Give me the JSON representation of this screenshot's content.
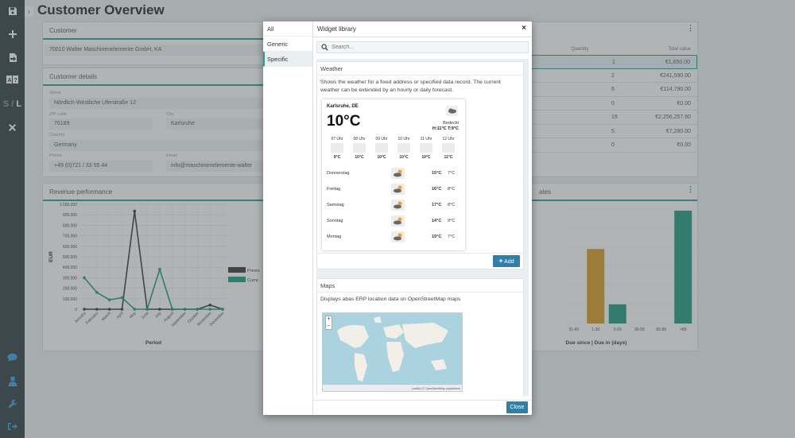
{
  "app": {
    "page_title": "Customer Overview",
    "sidebar": [
      "save-icon",
      "add-icon",
      "export-icon",
      "language-icon",
      "size-toggle",
      "close-icon",
      "chat-icon",
      "user-icon",
      "wrench-icon",
      "logout-icon"
    ],
    "size_toggle": {
      "small": "S",
      "sep": "/",
      "large": "L"
    }
  },
  "customer_panel": {
    "title": "Customer",
    "value": "70010 Walter Maschinenelemente GmbH, KA"
  },
  "customer_details": {
    "title": "Customer details",
    "street_label": "Street",
    "street": "Nördlich-Westliche Uferstraße 12",
    "zip_label": "ZIP code",
    "zip": "76189",
    "city_label": "City",
    "city": "Karlsruhe",
    "country_label": "Country",
    "country": "Germany",
    "phone_label": "Phone",
    "phone": "+49 (0)721 / 33 55 44",
    "email_label": "Email",
    "email": "info@maschinenelemente-walter"
  },
  "orders_table": {
    "col_quantity": "Quantity",
    "col_total": "Total value",
    "rows": [
      {
        "quantity": "1",
        "total": "€1,650.00"
      },
      {
        "quantity": "2",
        "total": "€241,590.00"
      },
      {
        "quantity": "6",
        "total": "€114,790.00"
      },
      {
        "quantity": "0",
        "total": "€0.00"
      },
      {
        "quantity": "19",
        "total": "€2,256,257.50"
      },
      {
        "quantity": "5",
        "total": "€7,280.00"
      },
      {
        "quantity": "0",
        "total": "€0.00"
      }
    ]
  },
  "revenue_panel": {
    "title": "Revenue performance"
  },
  "due_panel": {
    "title_fragment": "ates",
    "xlabel": "Due since | Due in (days)"
  },
  "chart_data": [
    {
      "type": "line",
      "ylabel": "EUR",
      "xlabel": "Period",
      "ylim": [
        0,
        1000000
      ],
      "yticks": [
        "1.000.000",
        "900.000",
        "800.000",
        "700.000",
        "600.000",
        "500.000",
        "400.000",
        "300.000",
        "200.000",
        "100.000",
        "0"
      ],
      "categories": [
        "January",
        "February",
        "March",
        "April",
        "May",
        "June",
        "July",
        "August",
        "September",
        "October",
        "November",
        "December"
      ],
      "series": [
        {
          "name": "Previo",
          "color": "#333333",
          "values": [
            0,
            0,
            0,
            0,
            935000,
            0,
            0,
            0,
            0,
            0,
            40000,
            0
          ]
        },
        {
          "name": "Curre",
          "color": "#1a9a7e",
          "values": [
            300000,
            160000,
            90000,
            110000,
            0,
            0,
            380000,
            0,
            0,
            0,
            0,
            0
          ]
        }
      ],
      "legend": "right"
    },
    {
      "type": "bar",
      "xlabel": "Due since | Due in (days)",
      "categories": [
        "31-60",
        "1-30",
        "0-29",
        "30-59",
        "60-89",
        ">89"
      ],
      "values": [
        0,
        0.66,
        0.17,
        0,
        0,
        1.0
      ],
      "colors": [
        "#d99a1e",
        "#d99a1e",
        "#1a9a7e",
        "#1a9a7e",
        "#1a9a7e",
        "#1a9a7e"
      ]
    }
  ],
  "widget_library": {
    "title": "Widget library",
    "categories": [
      {
        "label": "All",
        "active": false
      },
      {
        "label": "Generic",
        "active": false
      },
      {
        "label": "Specific",
        "active": true
      }
    ],
    "search_placeholder": "Search...",
    "weather": {
      "title": "Weather",
      "description": "Shows the weather for a fixed address or specified data record. The current weather can be extended by an hourly or daily forecast.",
      "city": "Karlsruhe, DE",
      "temp": "10°C",
      "condition": "Bedeckt",
      "hilo": "H:11°C  T:9°C",
      "hours": [
        {
          "time": "07 Uhr",
          "temp": "9°C"
        },
        {
          "time": "08 Uhr",
          "temp": "10°C"
        },
        {
          "time": "09 Uhr",
          "temp": "10°C"
        },
        {
          "time": "10 Uhr",
          "temp": "10°C"
        },
        {
          "time": "11 Uhr",
          "temp": "10°C"
        },
        {
          "time": "12 Uhr",
          "temp": "11°C"
        }
      ],
      "days": [
        {
          "day": "Donnerstag",
          "hi": "15°C",
          "lo": "7°C"
        },
        {
          "day": "Freitag",
          "hi": "16°C",
          "lo": "8°C"
        },
        {
          "day": "Samstag",
          "hi": "17°C",
          "lo": "8°C"
        },
        {
          "day": "Sonntag",
          "hi": "14°C",
          "lo": "9°C"
        },
        {
          "day": "Montag",
          "hi": "19°C",
          "lo": "7°C"
        }
      ],
      "add_label": "Add"
    },
    "maps": {
      "title": "Maps",
      "description": "Displays abas ERP location data on OpenStreetMap maps",
      "zoom_in": "+",
      "zoom_out": "−",
      "attribution": "Leaflet | © OpenStreetMap contributors"
    },
    "close_label": "Close",
    "close_x": "×"
  }
}
